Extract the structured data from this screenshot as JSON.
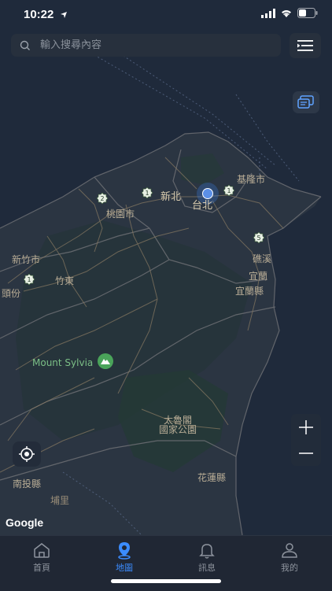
{
  "status_bar": {
    "time": "10:22"
  },
  "search": {
    "placeholder": "輸入搜尋內容"
  },
  "map": {
    "labels": {
      "keelung": "基隆市",
      "xinbei": "新北",
      "taipei": "台北",
      "taoyuan": "桃園市",
      "hsinchu_city": "新竹市",
      "zhubei": "竹東",
      "toufen": "頭份",
      "jiaoxi": "礁溪",
      "yilan": "宜蘭",
      "yilan_county": "宜蘭縣",
      "taroko_1": "太魯閣",
      "taroko_2": "國家公園",
      "nantou": "南投縣",
      "hualien": "花蓮縣",
      "puli": "埔里"
    },
    "poi": {
      "mount_sylvia": "Mount Sylvia"
    },
    "route_markers": [
      "2",
      "1",
      "1",
      "5",
      "1"
    ],
    "attribution": "Google"
  },
  "tabs": [
    {
      "label": "首頁",
      "icon": "home-icon",
      "active": false
    },
    {
      "label": "地圖",
      "icon": "map-pin-icon",
      "active": true
    },
    {
      "label": "訊息",
      "icon": "bell-icon",
      "active": false
    },
    {
      "label": "我的",
      "icon": "user-icon",
      "active": false
    }
  ],
  "colors": {
    "accent": "#3b8cff",
    "map_bg": "#1f2a3b",
    "tab_bg": "#202734"
  }
}
